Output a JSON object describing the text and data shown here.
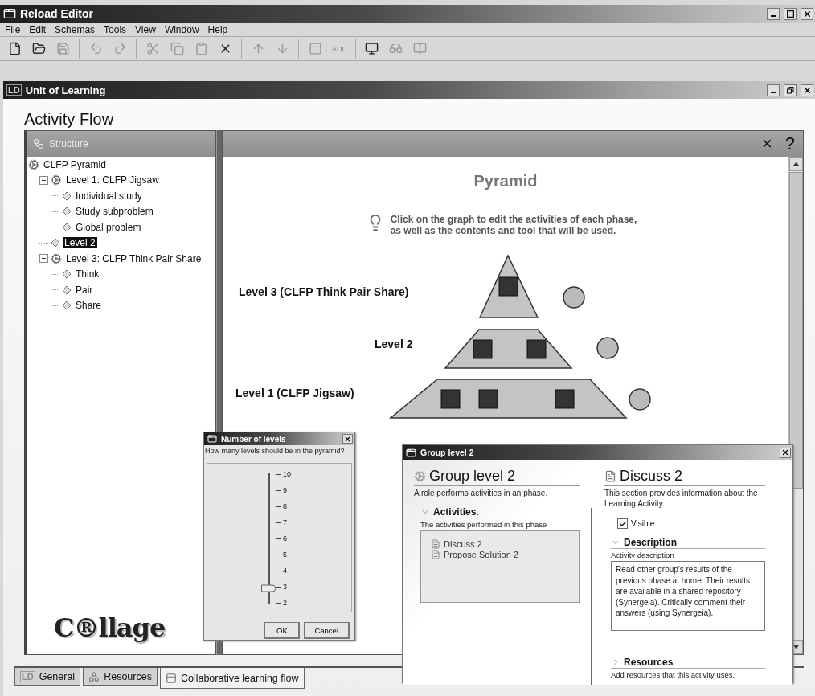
{
  "window": {
    "title": "Reload Editor"
  },
  "menu": [
    "File",
    "Edit",
    "Schemas",
    "Tools",
    "View",
    "Window",
    "Help"
  ],
  "toolbar": {
    "adl_label": "ADL"
  },
  "document": {
    "badge": "LD",
    "title": "Unit of Learning"
  },
  "heading": "Activity Flow",
  "structure": {
    "title": "Structure",
    "tree": [
      {
        "label": "CLFP Pyramid",
        "kind": "group",
        "selected": false,
        "children": [
          {
            "label": "Level 1: CLFP Jigsaw",
            "kind": "group",
            "selected": false,
            "expanded": true,
            "children": [
              {
                "label": "Individual study",
                "kind": "activity",
                "selected": false
              },
              {
                "label": "Study subproblem",
                "kind": "activity",
                "selected": false
              },
              {
                "label": "Global problem",
                "kind": "activity",
                "selected": false
              }
            ]
          },
          {
            "label": "Level 2",
            "kind": "activity",
            "selected": true
          },
          {
            "label": "Level 3: CLFP Think Pair Share",
            "kind": "group",
            "selected": false,
            "expanded": true,
            "children": [
              {
                "label": "Think",
                "kind": "activity",
                "selected": false
              },
              {
                "label": "Pair",
                "kind": "activity",
                "selected": false
              },
              {
                "label": "Share",
                "kind": "activity",
                "selected": false
              }
            ]
          }
        ]
      }
    ],
    "logo": "C®llage"
  },
  "flow": {
    "header_buttons": [
      "×",
      "?"
    ],
    "title": "Pyramid",
    "hint": [
      "Click on the graph to edit the activities of each phase,",
      "as well as the contents and tool that will be used."
    ],
    "levels": [
      "Level 3 (CLFP Think Pair Share)",
      "Level 2",
      "Level 1 (CLFP Jigsaw)"
    ]
  },
  "levels_dialog": {
    "title": "Number of levels",
    "question": "How many levels should be in the pyramid?",
    "ticks": [
      "10",
      "9",
      "8",
      "7",
      "6",
      "5",
      "4",
      "3",
      "2"
    ],
    "level": 0.125,
    "buttons": [
      "OK",
      "Cancel"
    ]
  },
  "group_dialog": {
    "title": "Group level 2",
    "left": {
      "heading": "Group level 2",
      "description": "A role performs activities in an phase.",
      "section": {
        "title": "Activities.",
        "expanded": true
      },
      "subtitle": "The activities performed in this phase",
      "activities": [
        "Discuss 2",
        "Propose Solution 2"
      ]
    },
    "right": {
      "heading": "Discuss 2",
      "description": "This section provides information about the Learning Activity.",
      "visible": {
        "label": "Visible",
        "checked": true
      },
      "description_section": {
        "title": "Description",
        "expanded": true
      },
      "field_label": "Activity description",
      "text": "Read other group's results of the previous phase at home. Their results are available in a shared repository (Synergeia). Critically comment their answers (using Synergeia).",
      "resources_section": {
        "title": "Resources",
        "expanded": false
      },
      "resources_hint": "Add resources that this activity uses."
    }
  },
  "bottom_tabs": [
    {
      "label": "General",
      "kind": "badge",
      "badge": "LD",
      "selected": false
    },
    {
      "label": "Resources",
      "kind": "resources",
      "selected": false
    },
    {
      "label": "Collaborative learning flow",
      "kind": "window",
      "selected": true
    }
  ]
}
